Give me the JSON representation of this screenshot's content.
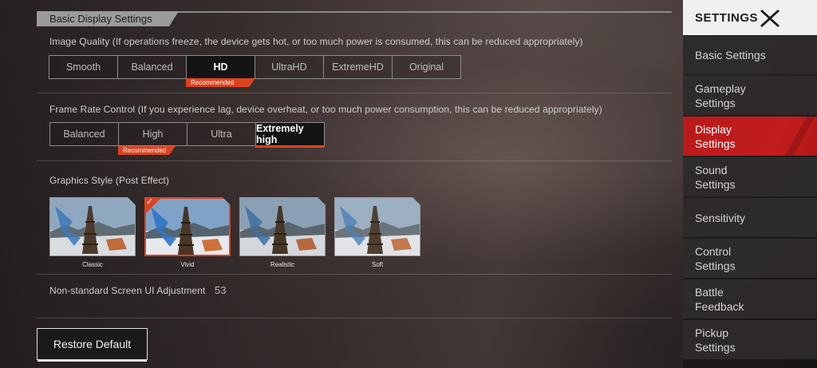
{
  "section": {
    "title": "Basic Display Settings"
  },
  "image_quality": {
    "label": "Image Quality (If operations freeze, the device gets hot, or too much power is consumed, this can be reduced appropriately)",
    "options": [
      "Smooth",
      "Balanced",
      "HD",
      "UltraHD",
      "ExtremeHD",
      "Original"
    ],
    "selected": "HD",
    "recommended_badge": "Recommended"
  },
  "frame_rate": {
    "label": "Frame Rate Control (If you experience lag, device overheat, or too much power consumption, this can be reduced appropriately)",
    "options": [
      "Balanced",
      "High",
      "Ultra",
      "Extremely high"
    ],
    "selected": "Extremely high",
    "recommended_badge": "Recommended"
  },
  "graphics_style": {
    "label": "Graphics Style (Post Effect)",
    "options": [
      "Classic",
      "Vivid",
      "Realistic",
      "Soft"
    ],
    "selected": "Vivid"
  },
  "ui_adjustment": {
    "label": "Non-standard Screen UI Adjustment",
    "value": "53"
  },
  "restore_label": "Restore Default",
  "sidebar": {
    "title": "SETTINGS",
    "close_icon": "close-x-icon",
    "items": [
      {
        "label": "Basic Settings"
      },
      {
        "label": "Gameplay Settings"
      },
      {
        "label": "Display Settings"
      },
      {
        "label": "Sound Settings"
      },
      {
        "label": "Sensitivity"
      },
      {
        "label": "Control Settings"
      },
      {
        "label": "Battle Feedback"
      },
      {
        "label": "Pickup Settings"
      }
    ],
    "active": "Display Settings"
  },
  "colors": {
    "accent": "#e0421f",
    "sidebar_active": "#c21d1d",
    "header_bg": "#f0f0f0"
  }
}
